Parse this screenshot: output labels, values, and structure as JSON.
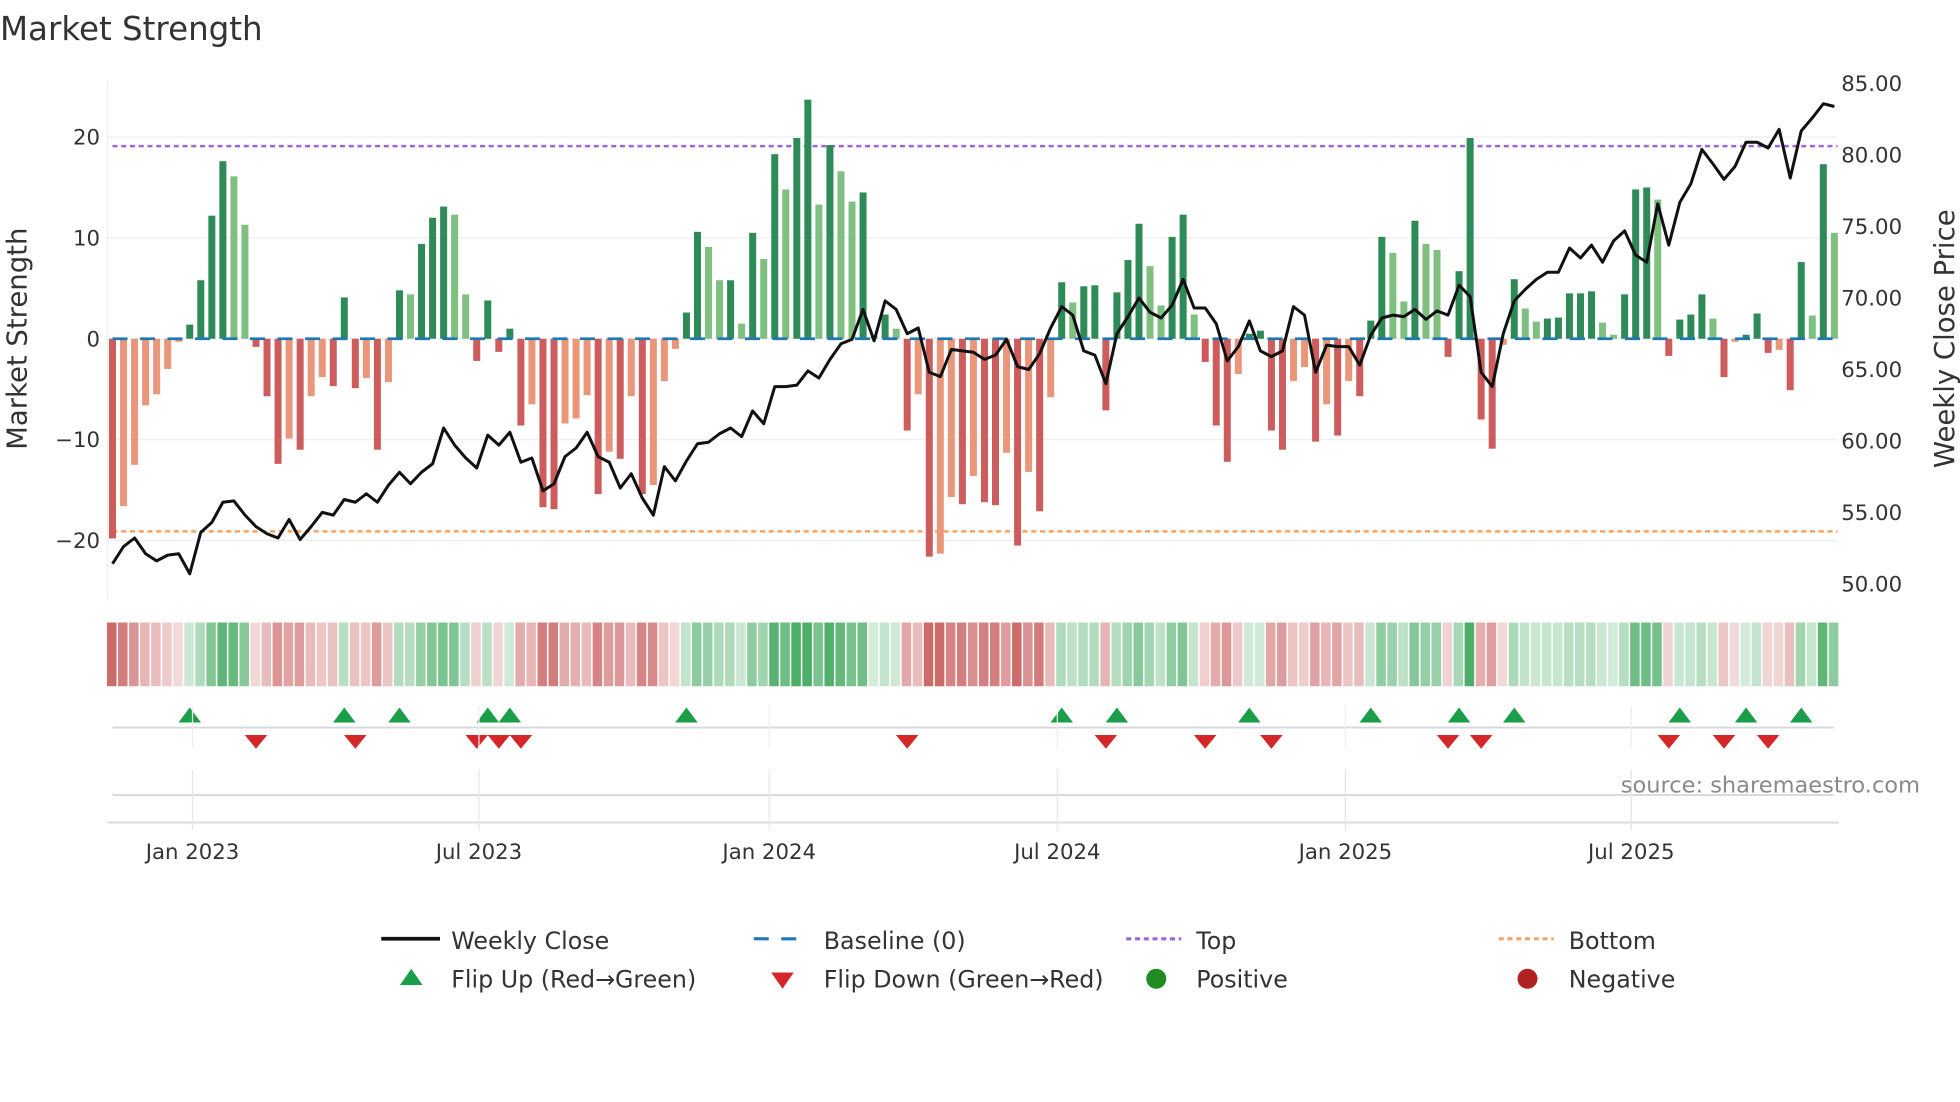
{
  "chart_data": {
    "type": "bar",
    "title": "Market Strength",
    "ylabel": "Market Strength",
    "y2label": "Weekly Close Price",
    "ylim": [
      -24,
      27
    ],
    "y2lim": [
      48,
      86
    ],
    "y_ticks": [
      {
        "value": 20,
        "label": "20"
      },
      {
        "value": 10,
        "label": "10"
      },
      {
        "value": 0,
        "label": "0"
      },
      {
        "value": -10,
        "label": "−10"
      },
      {
        "value": -20,
        "label": "−20"
      }
    ],
    "y2_ticks": [
      {
        "value": 85,
        "label": "85.00"
      },
      {
        "value": 80,
        "label": "80.00"
      },
      {
        "value": 75,
        "label": "75.00"
      },
      {
        "value": 70,
        "label": "70.00"
      },
      {
        "value": 65,
        "label": "65.00"
      },
      {
        "value": 60,
        "label": "60.00"
      },
      {
        "value": 55,
        "label": "55.00"
      },
      {
        "value": 50,
        "label": "50.00"
      }
    ],
    "x_ticks": [
      {
        "week": 7.25,
        "label": "Jan 2023"
      },
      {
        "week": 33.2,
        "label": "Jul 2023"
      },
      {
        "week": 59.5,
        "label": "Jan 2024"
      },
      {
        "week": 85.6,
        "label": "Jul 2024"
      },
      {
        "week": 111.7,
        "label": "Jan 2025"
      },
      {
        "week": 137.6,
        "label": "Jul 2025"
      }
    ],
    "top_threshold": 19.1,
    "bottom_threshold": -19.1,
    "strength": [
      -19.8,
      -16.6,
      -12.5,
      -6.6,
      -5.5,
      -3.0,
      -0.3,
      1.4,
      5.8,
      12.2,
      17.6,
      16.1,
      11.3,
      -0.8,
      -5.7,
      -12.4,
      -9.9,
      -11.0,
      -5.7,
      -3.8,
      -4.7,
      4.1,
      -4.9,
      -3.9,
      -11.0,
      -4.3,
      4.8,
      4.4,
      9.4,
      12.0,
      13.1,
      12.3,
      4.4,
      -2.2,
      3.8,
      -1.3,
      1.0,
      -8.6,
      -6.5,
      -16.7,
      -16.9,
      -8.4,
      -7.9,
      -5.6,
      -15.4,
      -11.2,
      -11.9,
      -5.7,
      -15.4,
      -14.5,
      -4.2,
      -1.0,
      2.6,
      10.6,
      9.1,
      5.8,
      5.8,
      1.5,
      10.5,
      7.9,
      18.3,
      14.8,
      19.9,
      23.7,
      13.3,
      19.2,
      16.6,
      13.6,
      14.5,
      0.3,
      2.4,
      1.0,
      -9.1,
      -5.5,
      -21.6,
      -21.3,
      -15.7,
      -16.4,
      -13.6,
      -16.2,
      -16.5,
      -11.3,
      -20.5,
      -13.2,
      -17.1,
      -5.8,
      5.6,
      3.6,
      5.2,
      5.3,
      -7.1,
      4.6,
      7.8,
      11.4,
      7.2,
      3.3,
      10.1,
      12.3,
      2.4,
      -2.3,
      -8.6,
      -12.2,
      -3.5,
      0.5,
      0.8,
      -9.1,
      -11.0,
      -4.2,
      -2.8,
      -10.2,
      -6.5,
      -9.6,
      -4.2,
      -5.7,
      1.8,
      10.1,
      8.5,
      3.7,
      11.7,
      9.4,
      8.8,
      -1.8,
      6.7,
      19.9,
      -8.0,
      -10.9,
      -0.6,
      5.9,
      3.0,
      1.7,
      2.0,
      2.1,
      4.5,
      4.5,
      4.7,
      1.6,
      0.4,
      4.4,
      14.8,
      15.0,
      13.8,
      -1.7,
      1.9,
      2.4,
      4.4,
      2.0,
      -3.8,
      -0.3,
      0.4,
      2.5,
      -1.4,
      -1.1,
      -5.1,
      7.6,
      2.3,
      17.3,
      10.5
    ],
    "weekly_close": [
      51.4,
      52.6,
      53.2,
      52.1,
      51.6,
      52.0,
      52.1,
      50.7,
      53.6,
      54.3,
      55.7,
      55.8,
      54.8,
      54.0,
      53.5,
      53.2,
      54.5,
      53.1,
      54.0,
      55.0,
      54.8,
      55.9,
      55.7,
      56.3,
      55.7,
      56.9,
      57.8,
      57.0,
      57.8,
      58.4,
      60.9,
      59.7,
      58.8,
      58.1,
      60.4,
      59.7,
      60.6,
      58.5,
      58.8,
      56.5,
      57.0,
      58.9,
      59.5,
      60.6,
      58.9,
      58.5,
      56.7,
      57.7,
      56.0,
      54.8,
      58.2,
      57.2,
      58.6,
      59.8,
      59.9,
      60.5,
      60.9,
      60.3,
      62.1,
      61.2,
      63.8,
      63.8,
      63.9,
      64.9,
      64.4,
      65.7,
      66.8,
      67.1,
      69.2,
      67.0,
      69.8,
      69.2,
      67.5,
      67.9,
      64.8,
      64.5,
      66.4,
      66.3,
      66.2,
      65.7,
      66.0,
      67.1,
      65.2,
      65.0,
      66.1,
      67.9,
      69.4,
      68.8,
      66.3,
      66.0,
      64.0,
      67.5,
      68.7,
      70.0,
      69.0,
      68.6,
      69.5,
      71.3,
      69.3,
      69.3,
      68.2,
      65.6,
      66.6,
      68.4,
      66.3,
      65.9,
      66.3,
      69.4,
      68.8,
      64.8,
      66.7,
      66.6,
      66.6,
      65.3,
      67.4,
      68.6,
      68.8,
      68.7,
      69.2,
      68.5,
      69.1,
      68.8,
      70.9,
      70.1,
      64.8,
      63.8,
      67.5,
      69.8,
      70.6,
      71.3,
      71.8,
      71.8,
      73.5,
      72.8,
      73.7,
      72.5,
      74.0,
      74.7,
      73.0,
      72.5,
      76.6,
      73.7,
      76.7,
      78.0,
      80.4,
      79.4,
      78.3,
      79.2,
      80.9,
      80.9,
      80.5,
      81.8,
      78.4,
      81.7,
      82.6,
      83.6,
      83.4
    ],
    "flip_up_weeks": [
      8,
      22,
      27,
      35,
      37,
      53,
      87,
      92,
      104,
      115,
      123,
      128,
      143,
      149,
      154
    ],
    "flip_down_weeks": [
      14,
      23,
      34,
      36,
      38,
      73,
      91,
      100,
      106,
      122,
      125,
      142,
      147,
      151
    ],
    "legend": {
      "weekly_close": "Weekly Close",
      "baseline": "Baseline (0)",
      "top": "Top",
      "bottom": "Bottom",
      "flip_up": "Flip Up (Red→Green)",
      "flip_down": "Flip Down (Green→Red)",
      "positive": "Positive",
      "negative": "Negative"
    },
    "source": "source: sharemaestro.com",
    "colors": {
      "up_strong": "#2e8b57",
      "up_weak": "#7fbf7f",
      "down_strong": "#cd5c5c",
      "down_weak": "#e9967a",
      "price": "#111111",
      "baseline": "#1f77b4",
      "top": "#9966dd",
      "bottom": "#f4a460",
      "flip_up": "#1a9e4a",
      "flip_down": "#d62728",
      "positive": "#228b22",
      "negative": "#b22222"
    }
  }
}
